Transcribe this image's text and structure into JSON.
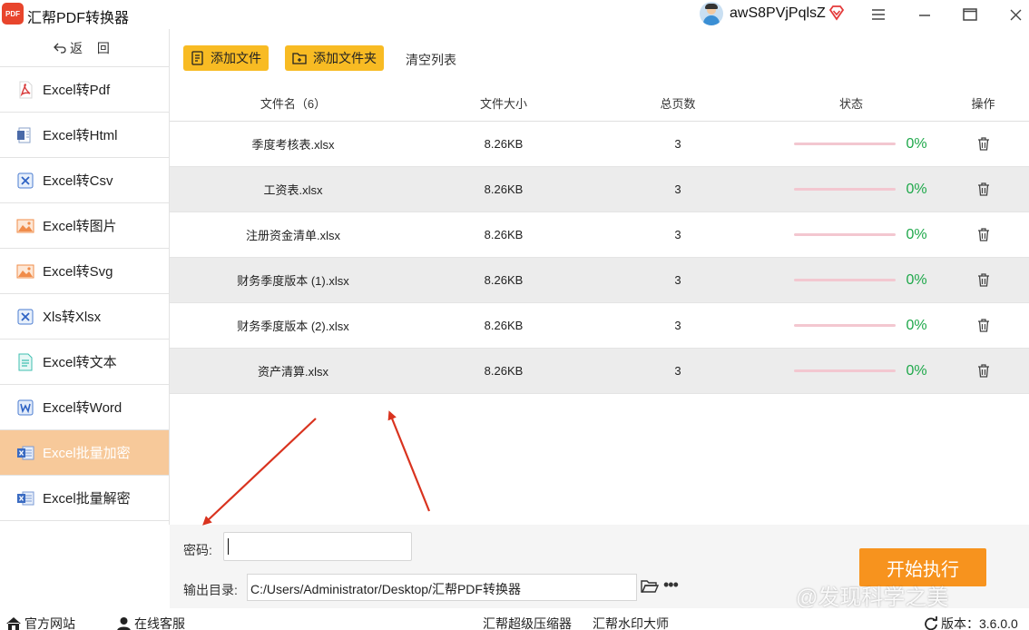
{
  "app": {
    "logo_text": "PDF",
    "title": "汇帮PDF转换器",
    "username": "awS8PVjPqlsZ"
  },
  "sidebar": {
    "back_label": "返 回",
    "items": [
      {
        "label": "Excel转Pdf",
        "icon": "pdf-icon"
      },
      {
        "label": "Excel转Html",
        "icon": "html-icon"
      },
      {
        "label": "Excel转Csv",
        "icon": "excel-x-icon"
      },
      {
        "label": "Excel转图片",
        "icon": "image-icon"
      },
      {
        "label": "Excel转Svg",
        "icon": "image-icon"
      },
      {
        "label": "Xls转Xlsx",
        "icon": "excel-x-icon"
      },
      {
        "label": "Excel转文本",
        "icon": "text-file-icon"
      },
      {
        "label": "Excel转Word",
        "icon": "word-icon"
      },
      {
        "label": "Excel批量加密",
        "icon": "excel-batch-icon",
        "active": true
      },
      {
        "label": "Excel批量解密",
        "icon": "excel-batch-icon"
      }
    ]
  },
  "toolbar": {
    "add_file": "添加文件",
    "add_folder": "添加文件夹",
    "clear_list": "清空列表"
  },
  "table": {
    "headers": {
      "name": "文件名（6）",
      "size": "文件大小",
      "pages": "总页数",
      "status": "状态",
      "op": "操作"
    },
    "rows": [
      {
        "name": "季度考核表.xlsx",
        "size": "8.26KB",
        "pages": "3",
        "progress": 0,
        "progress_text": "0%"
      },
      {
        "name": "工资表.xlsx",
        "size": "8.26KB",
        "pages": "3",
        "progress": 0,
        "progress_text": "0%"
      },
      {
        "name": "注册资金清单.xlsx",
        "size": "8.26KB",
        "pages": "3",
        "progress": 0,
        "progress_text": "0%"
      },
      {
        "name": "财务季度版本 (1).xlsx",
        "size": "8.26KB",
        "pages": "3",
        "progress": 0,
        "progress_text": "0%"
      },
      {
        "name": "财务季度版本 (2).xlsx",
        "size": "8.26KB",
        "pages": "3",
        "progress": 0,
        "progress_text": "0%"
      },
      {
        "name": "资产清算.xlsx",
        "size": "8.26KB",
        "pages": "3",
        "progress": 0,
        "progress_text": "0%"
      }
    ]
  },
  "bottom": {
    "password_label": "密码:",
    "password_value": "",
    "output_label": "输出目录:",
    "output_path": "C:/Users/Administrator/Desktop/汇帮PDF转换器",
    "start_label": "开始执行",
    "watermark": "@发现科学之美"
  },
  "statusbar": {
    "website": "官方网站",
    "support": "在线客服",
    "compressor": "汇帮超级压缩器",
    "watermark_tool": "汇帮水印大师",
    "version": "版本：3.6.0.0"
  },
  "colors": {
    "accent_yellow": "#f8bb23",
    "start_orange": "#f7931e",
    "active_sidebar": "#f7c99a",
    "progress_green": "#1ea84a",
    "annotation_red": "#d9331f"
  }
}
